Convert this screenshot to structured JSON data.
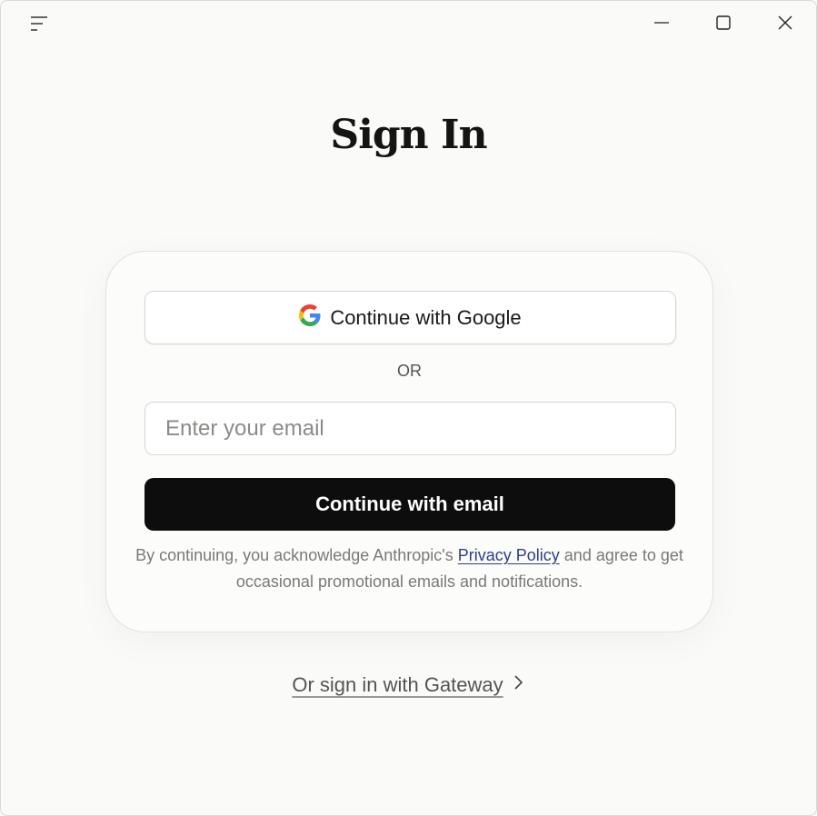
{
  "window": {
    "menu_icon": "menu-icon",
    "controls": [
      "minimize-icon",
      "maximize-icon",
      "close-icon"
    ]
  },
  "page": {
    "title": "Sign In"
  },
  "card": {
    "google_button_label": "Continue with Google",
    "google_icon": "google-logo-icon",
    "or_label": "OR",
    "email_placeholder": "Enter your email",
    "email_value": "",
    "email_button_label": "Continue with email",
    "legal_prefix": "By continuing, you acknowledge Anthropic's",
    "privacy_link_label": "Privacy Policy",
    "legal_suffix": "and agree to get occasional promotional emails and notifications."
  },
  "footer": {
    "gateway_label": "Or sign in with Gateway",
    "gateway_icon": "chevron-right-icon"
  },
  "colors": {
    "background": "#fafaf8",
    "primary_button": "#0d0d0d",
    "link": "#2a3f8f"
  }
}
